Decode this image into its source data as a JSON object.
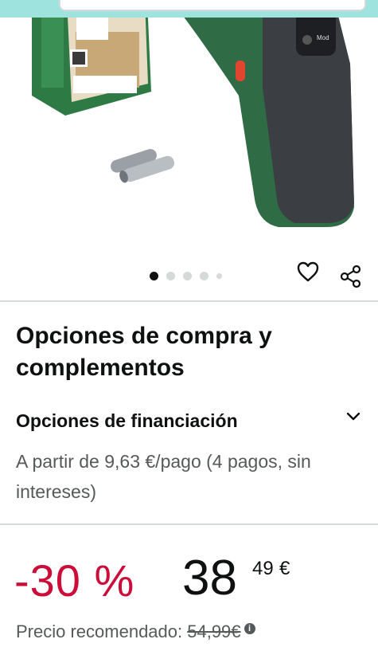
{
  "product": {
    "image_alt": "thermal-detector-product-image",
    "carousel": {
      "count": 5,
      "active_index": 0
    }
  },
  "purchase_options": {
    "title": "Opciones de compra y complementos"
  },
  "financing": {
    "title": "Opciones de financiación",
    "text": "A partir de 9,63 €/pago (4 pagos, sin intereses)"
  },
  "price": {
    "discount": "-30 %",
    "whole": "38",
    "fraction": "49",
    "currency": "€"
  },
  "rrp": {
    "label": "Precio recomendado: ",
    "value": "54,99€",
    "info": "i"
  },
  "colors": {
    "discount": "#cc0c39",
    "text": "#0f1111",
    "muted": "#565959",
    "topbar": "#9fe3df",
    "product_green": "#2f6b45"
  }
}
